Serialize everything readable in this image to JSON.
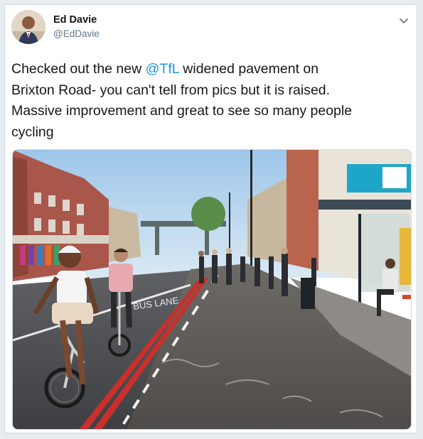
{
  "tweet": {
    "author_name": "Ed Davie",
    "author_handle": "@EdDavie",
    "text_lines": [
      {
        "before": "Checked out the new ",
        "mention": "@TfL",
        "after": " widened pavement on"
      },
      {
        "before": "Brixton Road- you can't tell from pics but it is raised.",
        "mention": "",
        "after": ""
      },
      {
        "before": "Massive improvement and great to see so many people",
        "mention": "",
        "after": ""
      },
      {
        "before": "cycling",
        "mention": "",
        "after": ""
      }
    ],
    "menu_icon": "chevron-down-icon",
    "photo_road_text": "BUS LANE"
  },
  "colors": {
    "mention": "#1b95e0",
    "name": "#14171a",
    "handle": "#657786",
    "border": "#cfd9de"
  }
}
